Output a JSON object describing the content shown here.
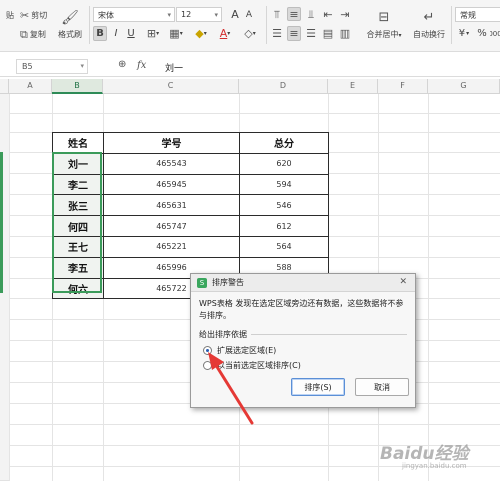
{
  "ribbon": {
    "cut": "剪切",
    "copy": "复制",
    "format_painter": "格式刷",
    "paste_partial": "贴",
    "font_name": "宋体",
    "font_size": "12",
    "merge_center": "合并居中",
    "wrap_text": "自动换行",
    "number_format": "常规",
    "currency": "¥",
    "percent": "%",
    "thousands": "000",
    "font_grow": "A⁺",
    "font_shrink": "A⁻"
  },
  "formula_bar": {
    "cell_ref": "B5",
    "fx": "fx",
    "value": "刘一"
  },
  "columns": [
    "A",
    "B",
    "C",
    "D",
    "E",
    "F",
    "G"
  ],
  "table": {
    "headers": [
      "姓名",
      "学号",
      "总分"
    ],
    "rows": [
      [
        "刘一",
        "465543",
        "620"
      ],
      [
        "李二",
        "465945",
        "594"
      ],
      [
        "张三",
        "465631",
        "546"
      ],
      [
        "何四",
        "465747",
        "612"
      ],
      [
        "王七",
        "465221",
        "564"
      ],
      [
        "李五",
        "465996",
        "588"
      ],
      [
        "何六",
        "465722",
        ""
      ]
    ]
  },
  "dialog": {
    "title": "排序警告",
    "message": "WPS表格 发现在选定区域旁边还有数据，这些数据将不参与排序。",
    "group_label": "给出排序依据",
    "option_expand": "扩展选定区域(E)",
    "option_current": "以当前选定区域排序(C)",
    "sort_button": "排序(S)",
    "cancel_button": "取消",
    "selected_option": "expand"
  },
  "watermark": {
    "text": "Baidu经验",
    "subtext": "jingyan.baidu.com"
  },
  "colors": {
    "selection": "#3b9b5a",
    "arrow": "#e53935",
    "dialog_logo": "#3aa65e"
  }
}
